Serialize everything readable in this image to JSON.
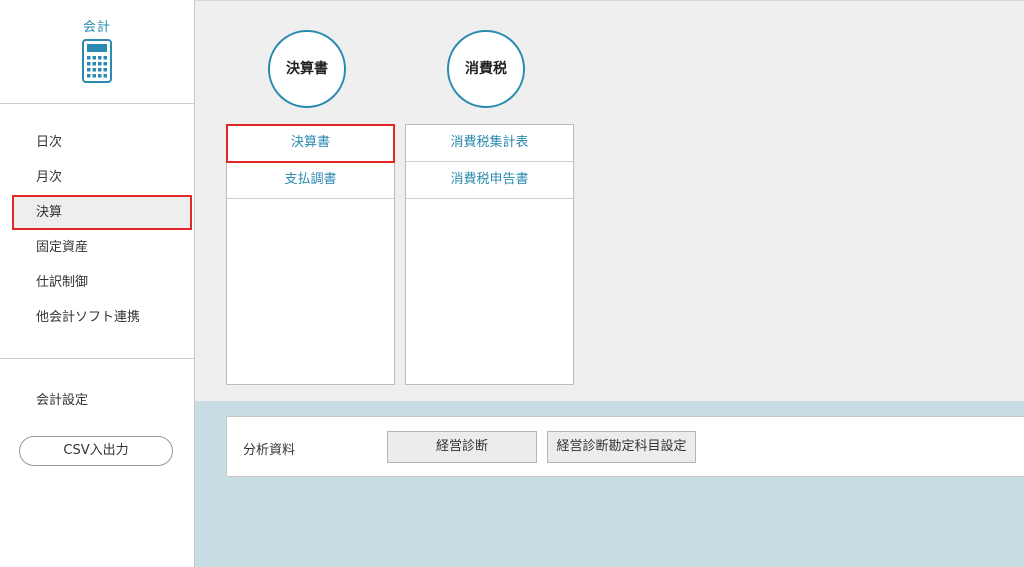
{
  "sidebar": {
    "brand_label": "会計",
    "brand_icon": "calculator-icon",
    "menu": [
      {
        "label": "日次"
      },
      {
        "label": "月次"
      },
      {
        "label": "決算"
      },
      {
        "label": "固定資産"
      },
      {
        "label": "仕訳制御"
      },
      {
        "label": "他会計ソフト連携"
      }
    ],
    "settings_label": "会計設定",
    "csv_button": "CSV入出力"
  },
  "groups": [
    {
      "title": "決算書",
      "items": [
        "決算書",
        "支払調書"
      ]
    },
    {
      "title": "消費税",
      "items": [
        "消費税集計表",
        "消費税申告書"
      ]
    }
  ],
  "analysis": {
    "label": "分析資料",
    "buttons": [
      "経営診断",
      "経営診断勘定科目設定"
    ]
  },
  "colors": {
    "accent": "#2a8ab0",
    "highlight": "#e32626",
    "content_bg": "#efefef",
    "lower_bg": "#c7dde3"
  }
}
